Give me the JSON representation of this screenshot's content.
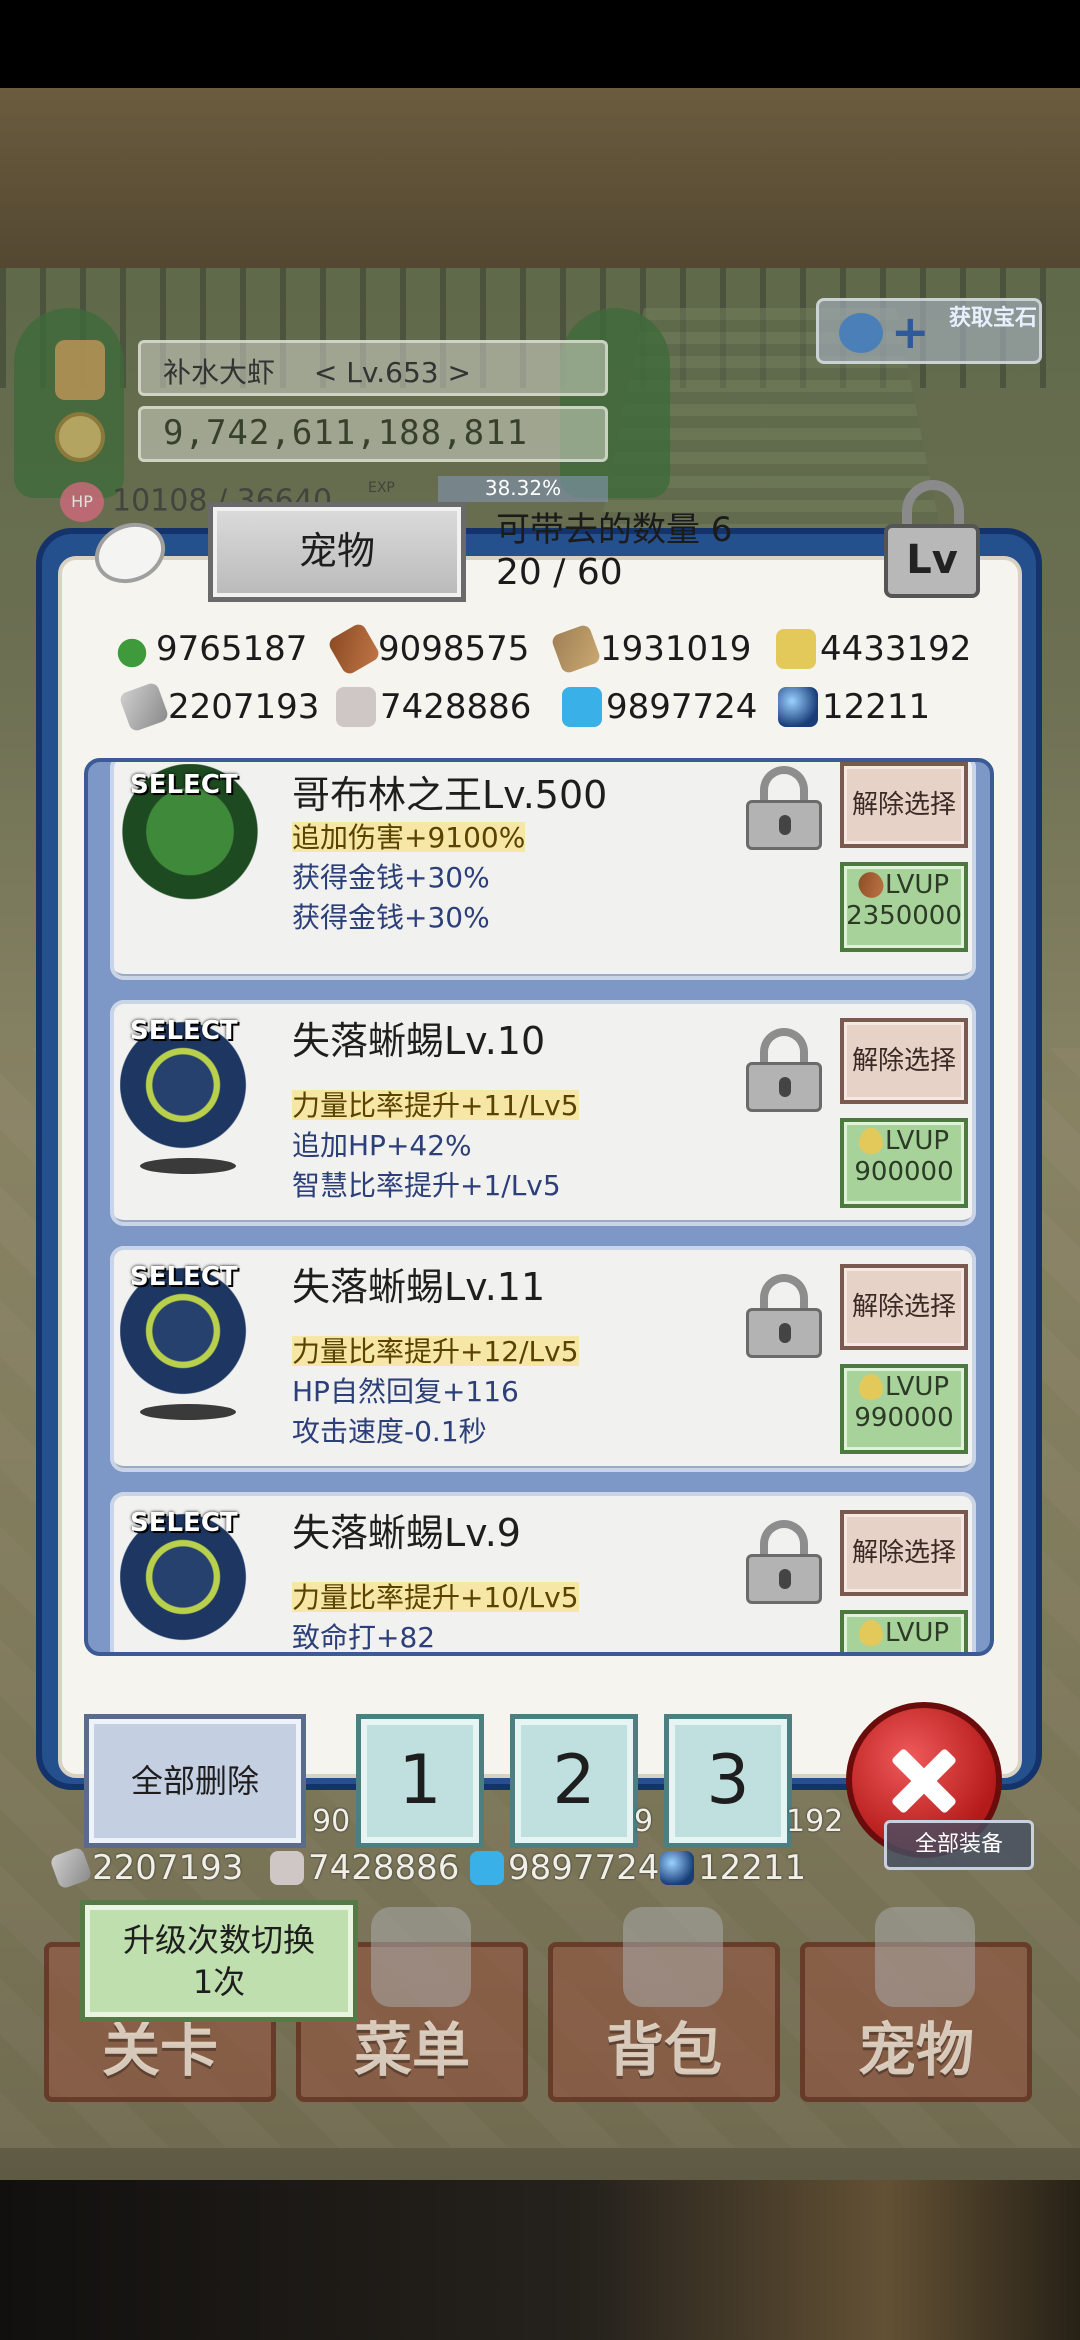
{
  "header": {
    "player_name": "补水大虾",
    "player_level": "< Lv.653 >",
    "gold": "9,742,611,188,811",
    "hp_text": "10108 / 36640",
    "hp_icon_label": "HP",
    "exp_label": "EXP",
    "exp_percent": "38.32%",
    "get_gem_label": "获取宝石"
  },
  "panel": {
    "title": "宠物",
    "capacity_label": "可带去的数量 6",
    "count": "20 / 60",
    "lv_lock_label": "Lv"
  },
  "resources": [
    {
      "icon": "herb-icon",
      "value": "9765187"
    },
    {
      "icon": "wood-log-icon",
      "value": "9098575"
    },
    {
      "icon": "plank-icon",
      "value": "1931019"
    },
    {
      "icon": "drop-icon",
      "value": "4433192"
    },
    {
      "icon": "iron-ingot-icon",
      "value": "2207193"
    },
    {
      "icon": "stone-icon",
      "value": "7428886"
    },
    {
      "icon": "blue-flame-icon",
      "value": "9897724"
    },
    {
      "icon": "blue-orb-icon",
      "value": "12211"
    }
  ],
  "pets": [
    {
      "select": "SELECT",
      "name": "哥布林之王Lv.500",
      "stats": [
        "追加伤害+9100%",
        "获得金钱+30%",
        "获得金钱+30%"
      ],
      "deselect": "解除选择",
      "lvup": "LVUP",
      "cost": "2350000",
      "cost_icon": "wood-log-icon",
      "image": "goblin-king-icon"
    },
    {
      "select": "SELECT",
      "name": "失落蜥蜴Lv.10",
      "stats": [
        "力量比率提升+11/Lv5",
        "追加HP+42%",
        "智慧比率提升+1/Lv5"
      ],
      "deselect": "解除选择",
      "lvup": "LVUP",
      "cost": "900000",
      "cost_icon": "drop-icon",
      "image": "lost-lizard-icon"
    },
    {
      "select": "SELECT",
      "name": "失落蜥蜴Lv.11",
      "stats": [
        "力量比率提升+12/Lv5",
        "HP自然回复+116",
        "攻击速度-0.1秒"
      ],
      "deselect": "解除选择",
      "lvup": "LVUP",
      "cost": "990000",
      "cost_icon": "drop-icon",
      "image": "lost-lizard-icon"
    },
    {
      "select": "SELECT",
      "name": "失落蜥蜴Lv.9",
      "stats": [
        "力量比率提升+10/Lv5",
        "致命打+82"
      ],
      "deselect": "解除选择",
      "lvup": "LVUP",
      "cost": "",
      "cost_icon": "drop-icon",
      "image": "lost-lizard-icon"
    }
  ],
  "bottom": {
    "delete_all": "全部删除",
    "pages": [
      "1",
      "2",
      "3"
    ],
    "row2": [
      {
        "icon": "iron-ingot-icon",
        "value": "2207193"
      },
      {
        "icon": "stone-icon",
        "value": "7428886"
      },
      {
        "icon": "blue-flame-icon",
        "value": "9897724"
      },
      {
        "icon": "blue-orb-icon",
        "value": "12211"
      }
    ],
    "partial_left": "90",
    "partial_mid": "9",
    "partial_right": "192",
    "hidden_equip": "全部装备",
    "upgrade_toggle_line1": "升级次数切换",
    "upgrade_toggle_line2": "1次",
    "nav": [
      "关卡",
      "菜单",
      "背包",
      "宠物"
    ]
  },
  "colors": {
    "panel_blue": "#24508e",
    "highlight_yellow": "#f7e7a6",
    "stat_text": "#2c3f78",
    "close_red": "#c12626",
    "lvup_green": "#a7d39a",
    "deselect_pink": "#e7d2c8"
  }
}
